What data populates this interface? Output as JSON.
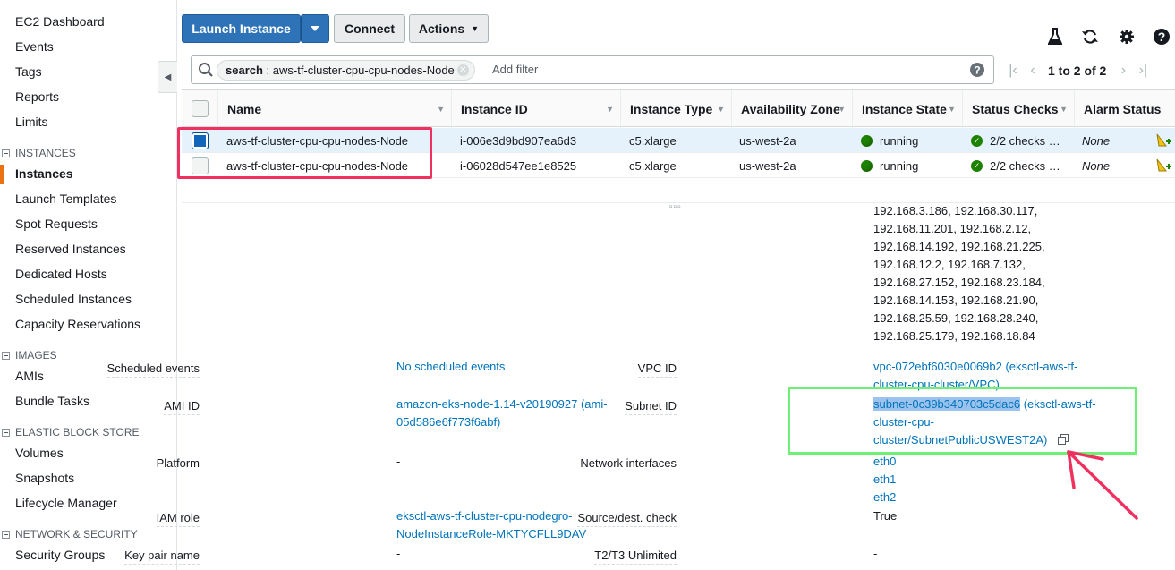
{
  "sidebar": {
    "items_top": [
      "EC2 Dashboard",
      "Events",
      "Tags",
      "Reports",
      "Limits"
    ],
    "sections": [
      {
        "title": "INSTANCES",
        "items": [
          "Instances",
          "Launch Templates",
          "Spot Requests",
          "Reserved Instances",
          "Dedicated Hosts",
          "Scheduled Instances",
          "Capacity Reservations"
        ]
      },
      {
        "title": "IMAGES",
        "items": [
          "AMIs",
          "Bundle Tasks"
        ]
      },
      {
        "title": "ELASTIC BLOCK STORE",
        "items": [
          "Volumes",
          "Snapshots",
          "Lifecycle Manager"
        ]
      },
      {
        "title": "NETWORK & SECURITY",
        "items": [
          "Security Groups"
        ]
      }
    ],
    "active_item": "Instances",
    "accent_color": "#ec7211"
  },
  "toolbar": {
    "launch_label": "Launch Instance",
    "connect_label": "Connect",
    "actions_label": "Actions",
    "icons": [
      "flask-icon",
      "refresh-icon",
      "gear-icon",
      "help-icon"
    ]
  },
  "search": {
    "token_key": "search",
    "token_value": "aws-tf-cluster-cpu-cpu-nodes-Node",
    "placeholder": "Add filter"
  },
  "pager": {
    "text": "1 to 2 of 2"
  },
  "table": {
    "columns": [
      "Name",
      "Instance ID",
      "Instance Type",
      "Availability Zone",
      "Instance State",
      "Status Checks",
      "Alarm Status"
    ],
    "rows": [
      {
        "selected": true,
        "name": "aws-tf-cluster-cpu-cpu-nodes-Node",
        "instance_id": "i-006e3d9bd907ea6d3",
        "type": "c5.xlarge",
        "az": "us-west-2a",
        "state": "running",
        "checks": "2/2 checks …",
        "alarm": "None"
      },
      {
        "selected": false,
        "name": "aws-tf-cluster-cpu-cpu-nodes-Node",
        "instance_id": "i-06028d547ee1e8525",
        "type": "c5.xlarge",
        "az": "us-west-2a",
        "state": "running",
        "checks": "2/2 checks …",
        "alarm": "None"
      }
    ]
  },
  "details": {
    "private_ips": [
      "192.168.3.186, 192.168.30.117,",
      "192.168.11.201, 192.168.2.12,",
      "192.168.14.192, 192.168.21.225,",
      "192.168.12.2, 192.168.7.132,",
      "192.168.27.152, 192.168.23.184,",
      "192.168.14.153, 192.168.21.90,",
      "192.168.25.59, 192.168.28.240,",
      "192.168.25.179, 192.168.18.84"
    ],
    "scheduled_events_label": "Scheduled events",
    "scheduled_events_value": "No scheduled events",
    "ami_id_label": "AMI ID",
    "ami_id_line1": "amazon-eks-node-1.14-v20190927 (ami-",
    "ami_id_line2": "05d586e6f773f6abf)",
    "platform_label": "Platform",
    "platform_value": "-",
    "iam_role_label": "IAM role",
    "iam_role_line1": "eksctl-aws-tf-cluster-cpu-nodegro-",
    "iam_role_line2": "NodeInstanceRole-MKTYCFLL9DAV",
    "key_pair_label": "Key pair name",
    "key_pair_value": "-",
    "vpc_id_label": "VPC ID",
    "vpc_id_line1": "vpc-072ebf6030e0069b2 (eksctl-aws-tf-",
    "vpc_id_line2": "cluster-cpu-cluster/VPC)",
    "subnet_id_label": "Subnet ID",
    "subnet_id_selected": "subnet-0c39b340703c5dac6",
    "subnet_id_line1_rest": " (eksctl-aws-tf-",
    "subnet_id_line2": "cluster-cpu-",
    "subnet_id_line3": "cluster/SubnetPublicUSWEST2A)",
    "network_interfaces_label": "Network interfaces",
    "network_interfaces": [
      "eth0",
      "eth1",
      "eth2"
    ],
    "source_dest_label": "Source/dest. check",
    "source_dest_value": "True",
    "t2t3_label": "T2/T3 Unlimited",
    "t2t3_value": "-"
  },
  "colors": {
    "primary_button": "#2e73b8",
    "link": "#0073bb",
    "running": "#1d8102",
    "annotation_red": "#f0315f",
    "annotation_green": "#6df073"
  }
}
